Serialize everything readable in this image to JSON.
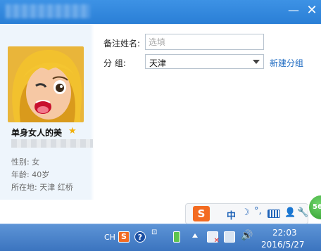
{
  "window": {
    "minimize_glyph": "—",
    "close_glyph": "✕"
  },
  "profile": {
    "nickname": "单身女人的美",
    "star_icon": "★",
    "gender": "性别: 女",
    "age": "年龄: 40岁",
    "location": "所在地: 天津  红桥"
  },
  "form": {
    "remark_label": "备注姓名:",
    "remark_placeholder": "选填",
    "group_label": "分    组:",
    "group_value": "天津",
    "new_group_link": "新建分组"
  },
  "green_badge": "56",
  "ime": {
    "logo": "S",
    "mode": "中",
    "moon": "☽",
    "punct": "°,",
    "user_icon": "👤",
    "settings_icon": "🔧"
  },
  "taskbar": {
    "lang": "CH",
    "sogou": "S",
    "help": "?",
    "pen": "⊡",
    "speaker": "🔊",
    "time": "22:03",
    "date": "2016/5/27"
  }
}
